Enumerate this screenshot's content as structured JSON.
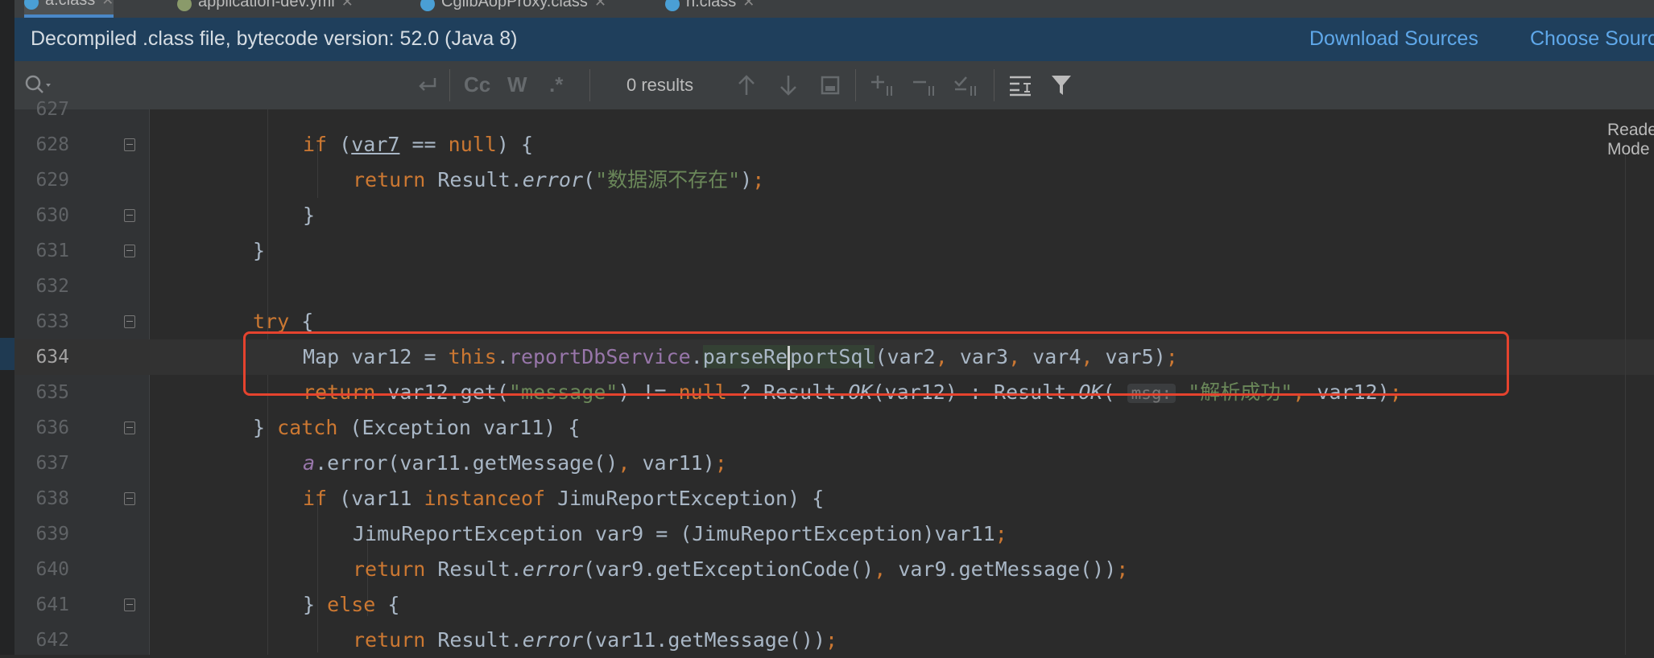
{
  "tabs": [
    {
      "label": "a.class",
      "icon": "class-icon",
      "active": true
    },
    {
      "label": "application-dev.yml",
      "icon": "gear-icon",
      "active": false
    },
    {
      "label": "CglibAopProxy.class",
      "icon": "class-icon",
      "active": false
    },
    {
      "label": "h.class",
      "icon": "class-icon",
      "active": false
    }
  ],
  "banner": {
    "text": "Decompiled .class file, bytecode version: 52.0 (Java 8)",
    "download_sources": "Download Sources",
    "choose_sources": "Choose Sources..."
  },
  "search": {
    "placeholder": "",
    "case_label": "Cc",
    "word_label": "W",
    "regex_label": ".*",
    "results": "0 results"
  },
  "reader_mode": "Reader Mode",
  "inlay_hint": "msg:",
  "lines": [
    "627",
    "628",
    "629",
    "630",
    "631",
    "632",
    "633",
    "634",
    "635",
    "636",
    "637",
    "638",
    "639",
    "640",
    "641",
    "642"
  ],
  "code": {
    "l628_var": "var7",
    "l629_str": "\"数据源不存在\"",
    "l634_service": "reportDbService",
    "l635_msg": "\"message\"",
    "l635_success": "\"解析成功\"",
    "l638_exc": "JimuReportException"
  },
  "colors": {
    "banner_bg": "#1f3f5c",
    "link": "#5fa8ea",
    "keyword": "#cc7832",
    "string": "#6a8759",
    "field": "#9876aa",
    "annotation_box": "#e5432e"
  }
}
